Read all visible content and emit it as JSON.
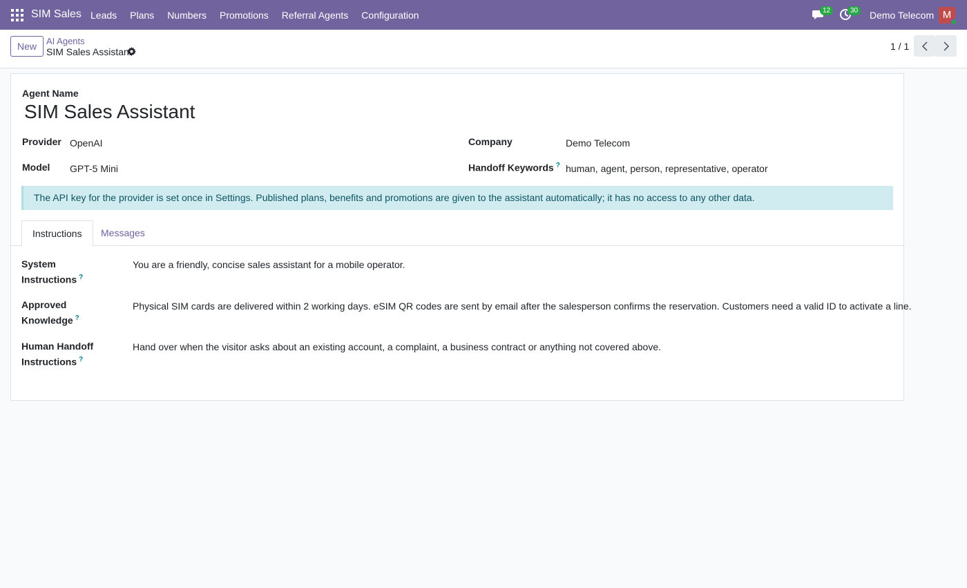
{
  "navbar": {
    "app_name": "SIM Sales",
    "menu": [
      "Leads",
      "Plans",
      "Numbers",
      "Promotions",
      "Referral Agents",
      "Configuration"
    ],
    "chat_count": "12",
    "activity_count": "30",
    "company": "Demo Telecom",
    "avatar_initial": "M",
    "bg_color": "#71639e"
  },
  "control_panel": {
    "new_label": "New",
    "breadcrumb_parent": "AI Agents",
    "breadcrumb_current": "SIM Sales Assistant",
    "pager": "1 / 1"
  },
  "form": {
    "agent_name_label": "Agent Name",
    "agent_name": "SIM Sales Assistant",
    "provider_label": "Provider",
    "provider": "OpenAI",
    "model_label": "Model",
    "model": "GPT-5 Mini",
    "company_label": "Company",
    "company": "Demo Telecom",
    "handoff_keywords_label": "Handoff Keywords",
    "handoff_keywords": "human, agent, person, representative, operator",
    "help_mark": "?",
    "alert": "The API key for the provider is set once in Settings. Published plans, benefits and promotions are given to the assistant automatically; it has no access to any other data."
  },
  "tabs": {
    "instructions": "Instructions",
    "messages": "Messages"
  },
  "instructions": {
    "system_label_line1": "System Instructions",
    "system_value": "You are a friendly, concise sales assistant for a mobile operator.",
    "approved_label_line1": "Approved",
    "approved_label_line2": "Knowledge",
    "approved_value": "Physical SIM cards are delivered within 2 working days. eSIM QR codes are sent by email after the salesperson confirms the reservation. Customers need a valid ID to activate a line.",
    "handoff_label_line1": "Human Handoff",
    "handoff_label_line2": "Instructions",
    "handoff_value": "Hand over when the visitor asks about an existing account, a complaint, a business contract or anything not covered above."
  }
}
